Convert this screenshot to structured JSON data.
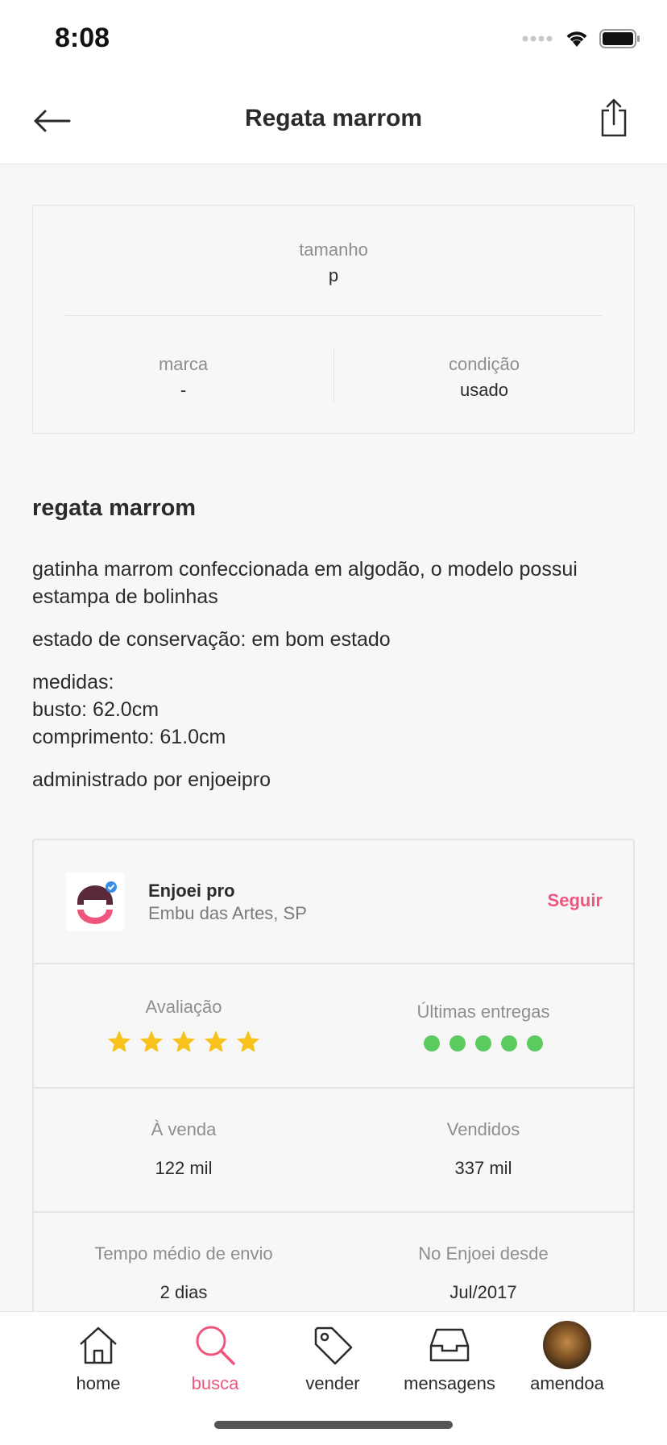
{
  "status_bar": {
    "time": "8:08"
  },
  "nav": {
    "title": "Regata marrom"
  },
  "attributes": {
    "size_label": "tamanho",
    "size_value": "p",
    "brand_label": "marca",
    "brand_value": "-",
    "condition_label": "condição",
    "condition_value": "usado"
  },
  "description": {
    "title": "regata marrom",
    "paragraph1": "gatinha marrom confeccionada em algodão, o modelo possui estampa de bolinhas",
    "paragraph2": "estado de conservação: em bom estado",
    "measures_title": "medidas:",
    "bust": "busto: 62.0cm",
    "length": "comprimento: 61.0cm",
    "managed": "administrado por enjoeipro"
  },
  "seller": {
    "name": "Enjoei pro",
    "location": "Embu das Artes, SP",
    "follow_label": "Seguir",
    "rating_label": "Avaliação",
    "rating_stars": 5,
    "deliveries_label": "Últimas entregas",
    "deliveries_dots": 5,
    "for_sale_label": "À venda",
    "for_sale_value": "122 mil",
    "sold_label": "Vendidos",
    "sold_value": "337 mil",
    "ship_time_label": "Tempo médio de envio",
    "ship_time_value": "2 dias",
    "since_label": "No Enjoei desde",
    "since_value": "Jul/2017"
  },
  "tabs": [
    {
      "label": "home",
      "icon": "home-icon"
    },
    {
      "label": "busca",
      "icon": "search-icon"
    },
    {
      "label": "vender",
      "icon": "tag-icon"
    },
    {
      "label": "mensagens",
      "icon": "inbox-icon"
    },
    {
      "label": "amendoa",
      "icon": "avatar"
    }
  ],
  "colors": {
    "accent": "#f0557d",
    "star": "#f8c21c",
    "delivery_dot": "#5ccb5f",
    "brand_dark": "#5a2a3a"
  }
}
